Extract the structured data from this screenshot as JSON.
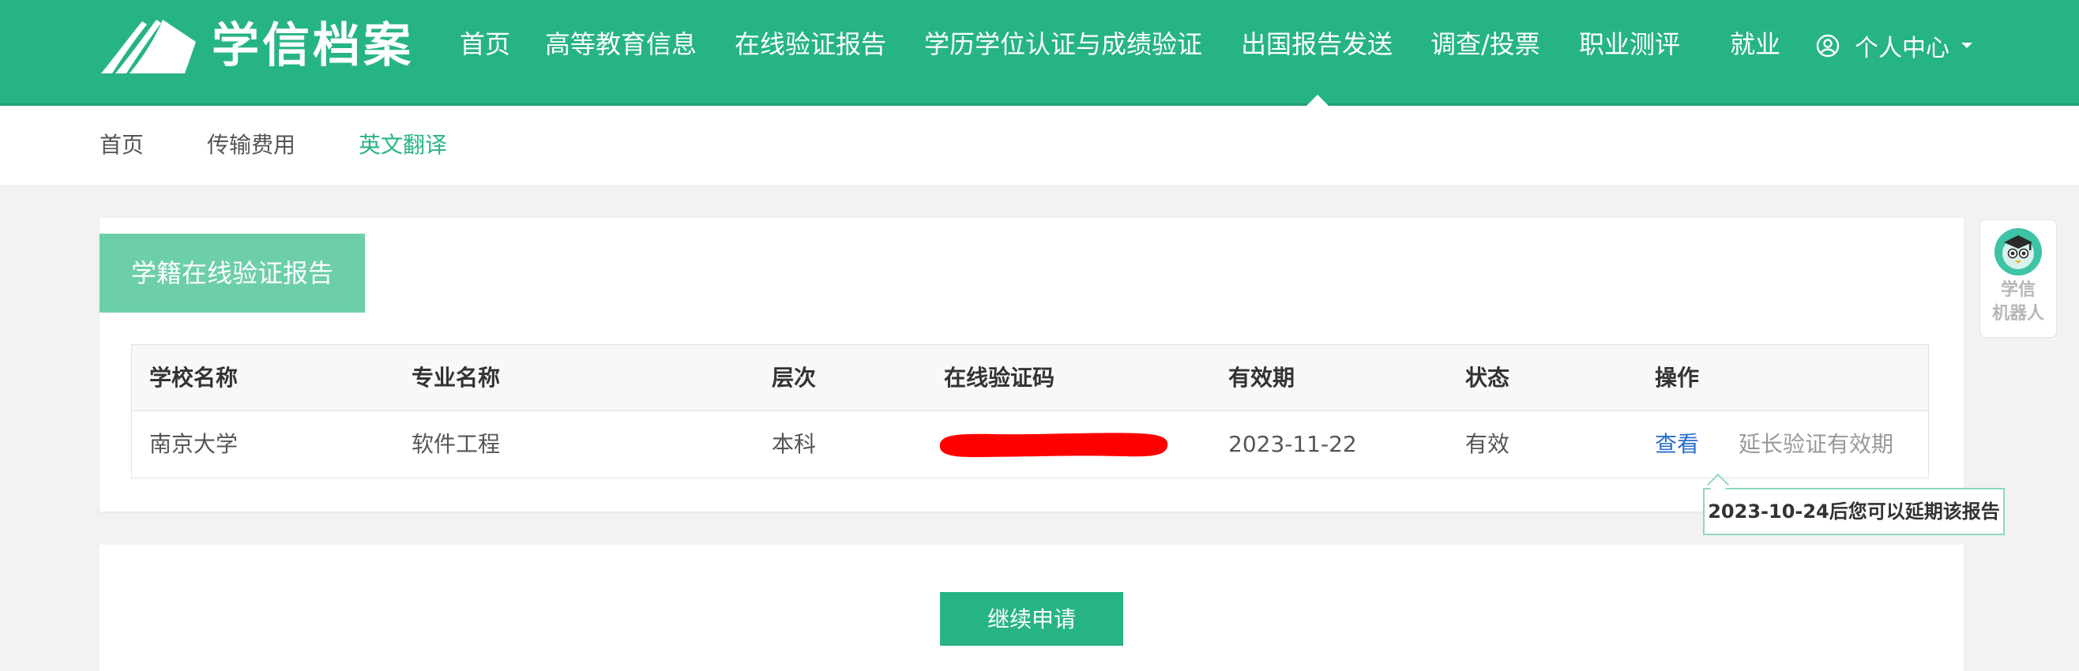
{
  "brand": {
    "name": "学信档案"
  },
  "nav": {
    "items": [
      {
        "label": "首页"
      },
      {
        "label": "高等教育信息"
      },
      {
        "label": "在线验证报告"
      },
      {
        "label": "学历学位认证与成绩验证"
      },
      {
        "label": "出国报告发送"
      },
      {
        "label": "调查/投票"
      },
      {
        "label": "职业测评"
      },
      {
        "label": "就业"
      }
    ],
    "active_index": 4,
    "user_center": "个人中心"
  },
  "subnav": {
    "items": [
      {
        "label": "首页"
      },
      {
        "label": "传输费用"
      },
      {
        "label": "英文翻译"
      }
    ],
    "active_index": 2
  },
  "report": {
    "tab_title": "学籍在线验证报告",
    "columns": [
      "学校名称",
      "专业名称",
      "层次",
      "在线验证码",
      "有效期",
      "状态",
      "操作"
    ],
    "rows": [
      {
        "school": "南京大学",
        "major": "软件工程",
        "level": "本科",
        "code": "",
        "expiry": "2023-11-22",
        "status": "有效",
        "action_view": "查看",
        "action_extend": "延长验证有效期"
      }
    ],
    "tooltip": "2023-10-24后您可以延期该报告"
  },
  "continue": {
    "label": "继续申请"
  },
  "robot": {
    "line1": "学信",
    "line2": "机器人"
  },
  "colors": {
    "primary": "#27b483",
    "tab": "#6dcfaa",
    "link": "#2a6ed1",
    "redaction": "#ff0000"
  }
}
